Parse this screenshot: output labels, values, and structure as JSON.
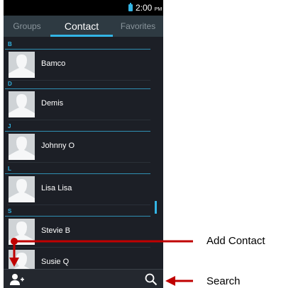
{
  "status_bar": {
    "time": "2:00",
    "ampm": "PM"
  },
  "tabs": [
    {
      "label": "Groups",
      "active": false
    },
    {
      "label": "Contact",
      "active": true
    },
    {
      "label": "Favorites",
      "active": false
    }
  ],
  "sections": [
    {
      "letter": "B",
      "contacts": [
        "Bamco"
      ]
    },
    {
      "letter": "D",
      "contacts": [
        "Demis"
      ]
    },
    {
      "letter": "J",
      "contacts": [
        "Johnny O"
      ]
    },
    {
      "letter": "L",
      "contacts": [
        "Lisa Lisa"
      ]
    },
    {
      "letter": "S",
      "contacts": [
        "Stevie B",
        "Susie Q"
      ]
    }
  ],
  "bottom_bar": {
    "left_icon": "add-contact-icon",
    "right_icon": "search-icon"
  },
  "annotations": {
    "add_contact": "Add Contact",
    "search": "Search"
  },
  "colors": {
    "accent": "#33b5e5",
    "annotation_arrow": "#c00000",
    "background": "#1c1f26"
  }
}
